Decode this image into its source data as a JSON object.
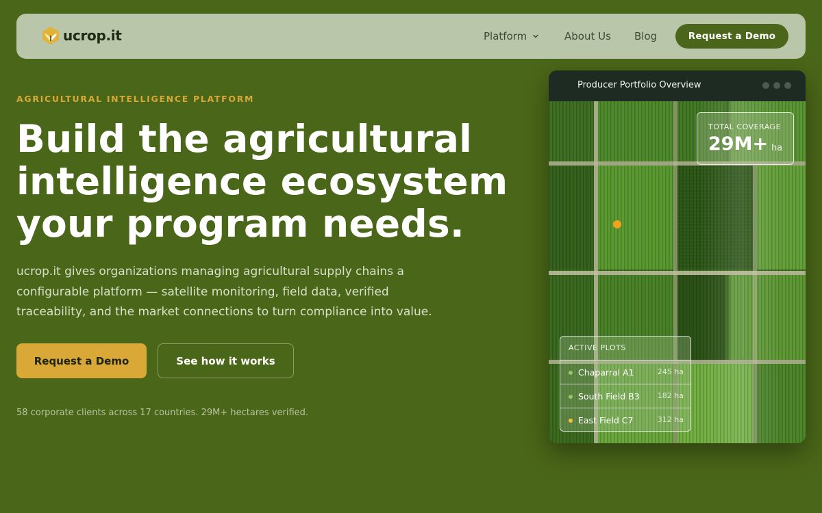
{
  "nav": {
    "brand": "ucrop.it",
    "links": [
      {
        "label": "Platform"
      },
      {
        "label": "About Us"
      },
      {
        "label": "Blog"
      }
    ],
    "cta": "Request a Demo"
  },
  "hero": {
    "eyebrow": "AGRICULTURAL INTELLIGENCE PLATFORM",
    "headline_lines": [
      "Build the agricultural",
      "intelligence ecosystem",
      "your program needs."
    ],
    "subcopy_lines": [
      "ucrop.it gives organizations managing agricultural supply chains a",
      "configurable platform — satellite monitoring, field data, verified",
      "traceability, and the market connections to turn compliance into value."
    ],
    "primary_button": "Request a Demo",
    "secondary_button": "See how it works",
    "proof": "58 corporate clients across 17 countries. 29M+ hectares verified."
  },
  "dashboard": {
    "title": "Producer Portfolio Overview",
    "coverage": {
      "label": "TOTAL COVERAGE",
      "value": "29M+",
      "unit": "ha"
    },
    "plots": {
      "label": "ACTIVE PLOTS",
      "items": [
        {
          "name": "Chaparral A1",
          "area": "245 ha",
          "status_color": "#9bc46a"
        },
        {
          "name": "South Field B3",
          "area": "182 ha",
          "status_color": "#9bc46a"
        },
        {
          "name": "East Field C7",
          "area": "312 ha",
          "status_color": "#f2c23a"
        }
      ]
    }
  },
  "colors": {
    "page_bg": "#4a6618",
    "nav_bg": "#bac6a9",
    "accent_gold": "#d9a836",
    "dark_green": "#4b651b",
    "marker": "#f0a31e"
  },
  "icons": {
    "logo": "leaf-logo-icon",
    "dropdown": "chevron-down-icon",
    "window_controls": "window-dot-icon",
    "map_marker": "location-dot-icon"
  }
}
